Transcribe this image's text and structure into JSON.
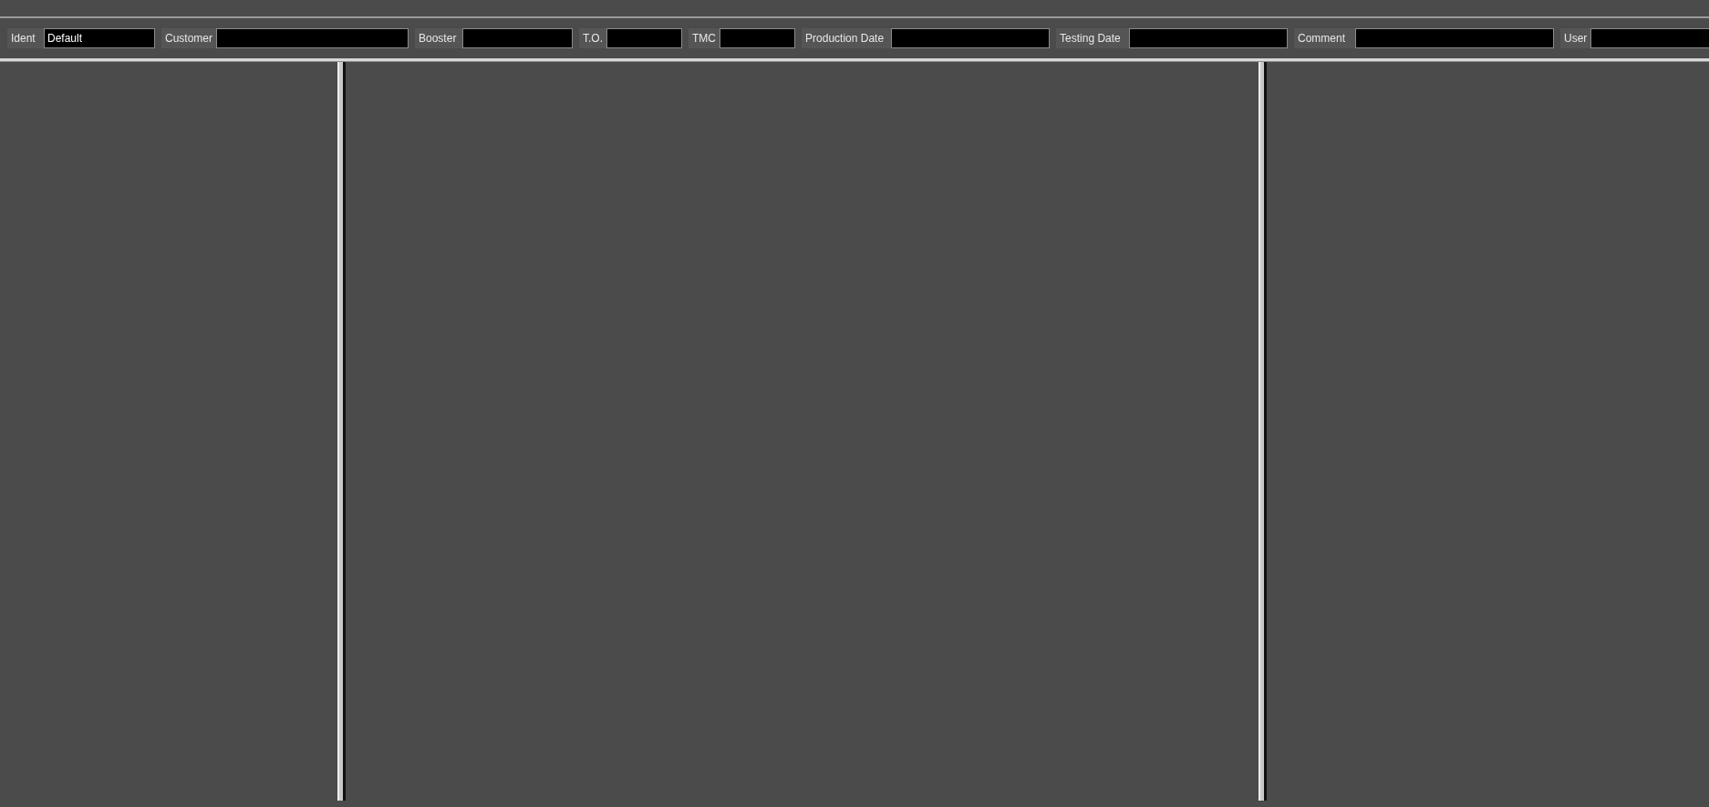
{
  "toolbar": {
    "fields": [
      {
        "label": "Ident",
        "value": "Default"
      },
      {
        "label": "Customer"
      },
      {
        "label": "Booster"
      },
      {
        "label": "T.O."
      },
      {
        "label": "TMC"
      },
      {
        "label": "Production Date"
      },
      {
        "label": "Testing Date"
      },
      {
        "label": "Comment"
      },
      {
        "label": "User"
      }
    ]
  }
}
